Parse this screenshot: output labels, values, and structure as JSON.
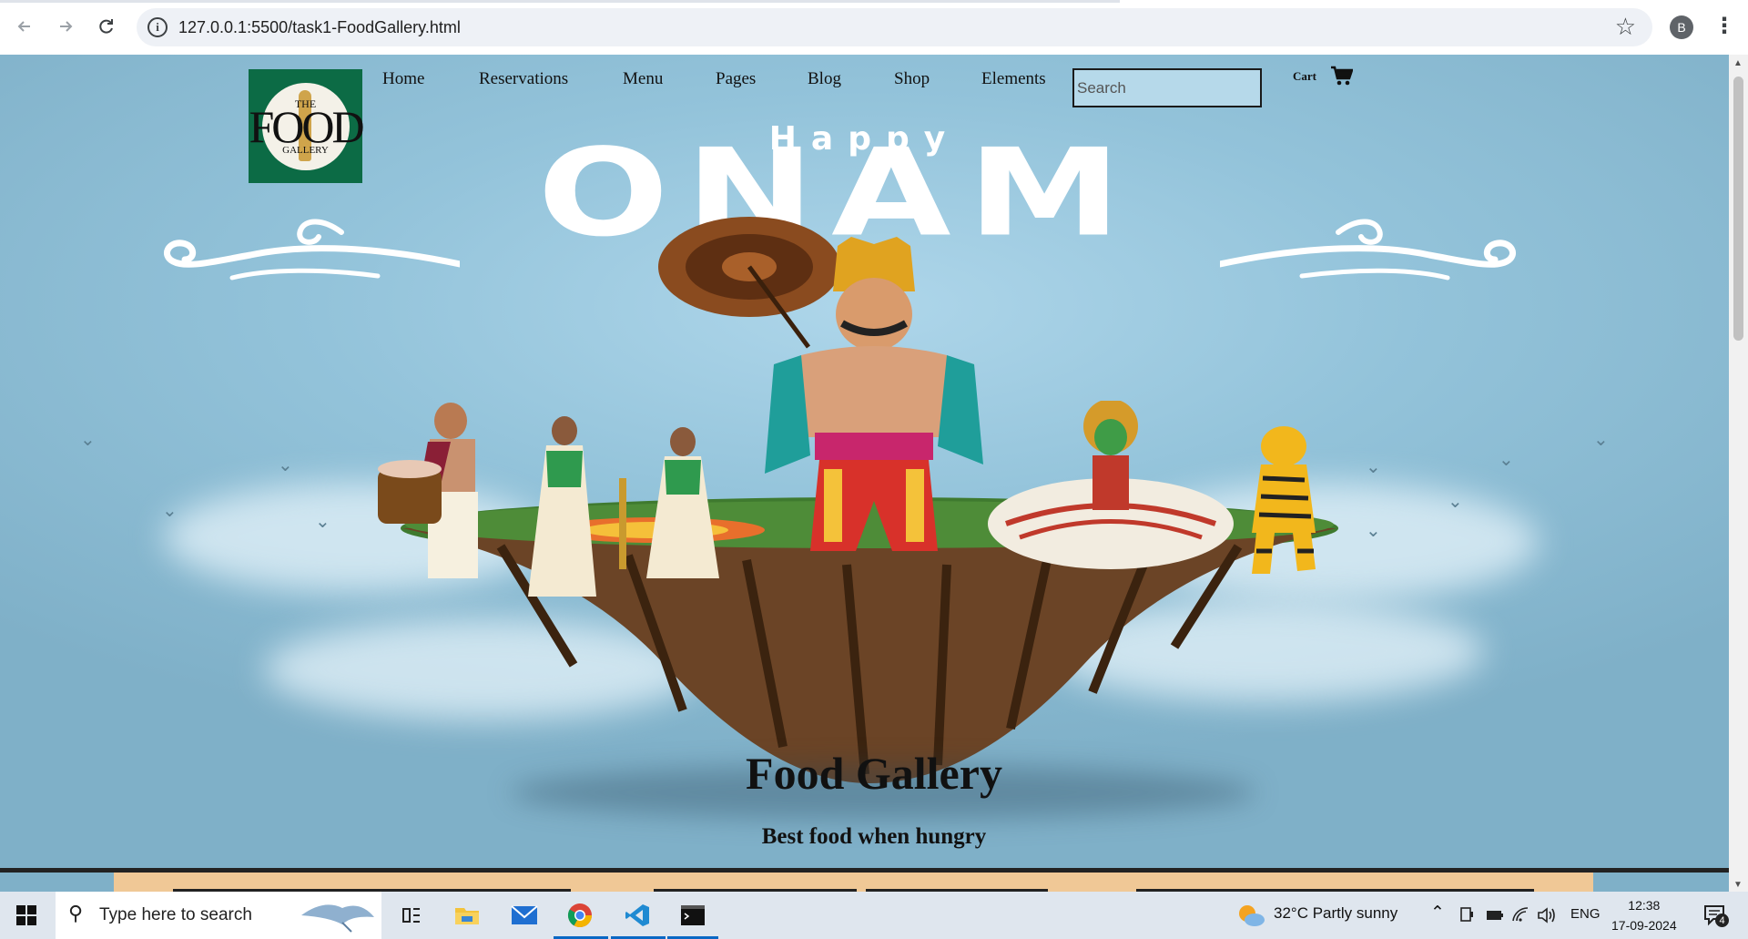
{
  "browser": {
    "url": "127.0.0.1:5500/task1-FoodGallery.html",
    "profile_initial": "B",
    "back_icon": "arrow-left-icon",
    "forward_icon": "arrow-right-icon",
    "reload_icon": "reload-icon"
  },
  "site": {
    "logo": {
      "top": "THE",
      "word": "FOOD",
      "bottom": "GALLERY"
    },
    "nav": [
      "Home",
      "Reservations",
      "Menu",
      "Pages",
      "Blog",
      "Shop",
      "Elements"
    ],
    "search_placeholder": "Search",
    "cart_label": "Cart",
    "banner_happy": "Happy",
    "banner_onam": "ONAM",
    "title": "Food Gallery",
    "tagline": "Best food when hungry"
  },
  "taskbar": {
    "search_placeholder": "Type here to search",
    "weather": "32°C  Partly sunny",
    "language": "ENG",
    "time": "12:38",
    "date": "17-09-2024",
    "notification_count": "4"
  },
  "colors": {
    "logo_bg": "#0c6b45",
    "hero_sky": "#93c3da",
    "peach_strip": "#f0c896",
    "taskbar_accent": "#0a68c4"
  }
}
